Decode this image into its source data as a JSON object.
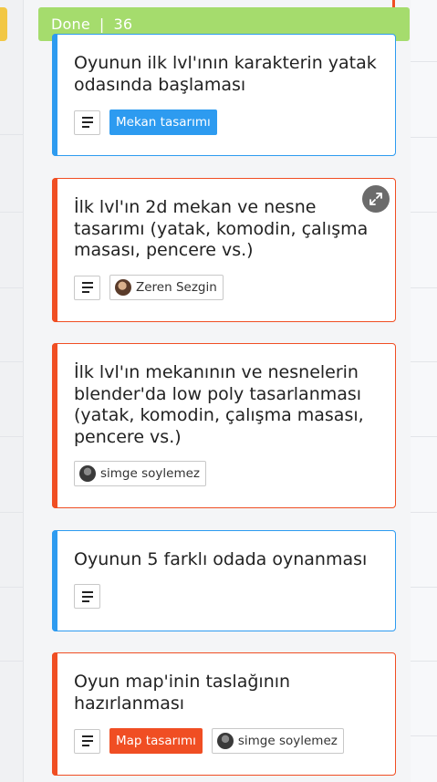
{
  "column": {
    "name": "Done",
    "separator": "|",
    "count": "36",
    "color": "#a5dc6d"
  },
  "colors": {
    "blue": "#2d9bf0",
    "red": "#f04e23",
    "left_tab": "#f2c744"
  },
  "cards": [
    {
      "title": "Oyunun ilk lvl'ının karakterin yatak odasında başlaması",
      "priority_color": "blue",
      "has_description": true,
      "label": "Mekan tasarımı",
      "label_color": "blue",
      "member": null
    },
    {
      "title": "İlk lvl'ın 2d mekan ve nesne tasarımı (yatak, komodin, çalışma masası, pencere vs.)",
      "priority_color": "red",
      "has_description": true,
      "label": null,
      "member": "Zeren Sezgin",
      "show_expand": true,
      "expand_icon": "expand-arrows-icon"
    },
    {
      "title": "İlk lvl'ın mekanının ve nesnelerin blender'da low poly tasarlanması (yatak, komodin, çalışma masası, pencere vs.)",
      "priority_color": "red",
      "has_description": false,
      "label": null,
      "member": "simge soylemez"
    },
    {
      "title": "Oyunun 5 farklı odada oynanması",
      "priority_color": "blue",
      "has_description": true,
      "label": null,
      "member": null
    },
    {
      "title": "Oyun map'inin taslağının hazırlanması",
      "priority_color": "red",
      "has_description": true,
      "label": "Map tasarımı",
      "label_color": "red",
      "member": "simge soylemez"
    }
  ]
}
